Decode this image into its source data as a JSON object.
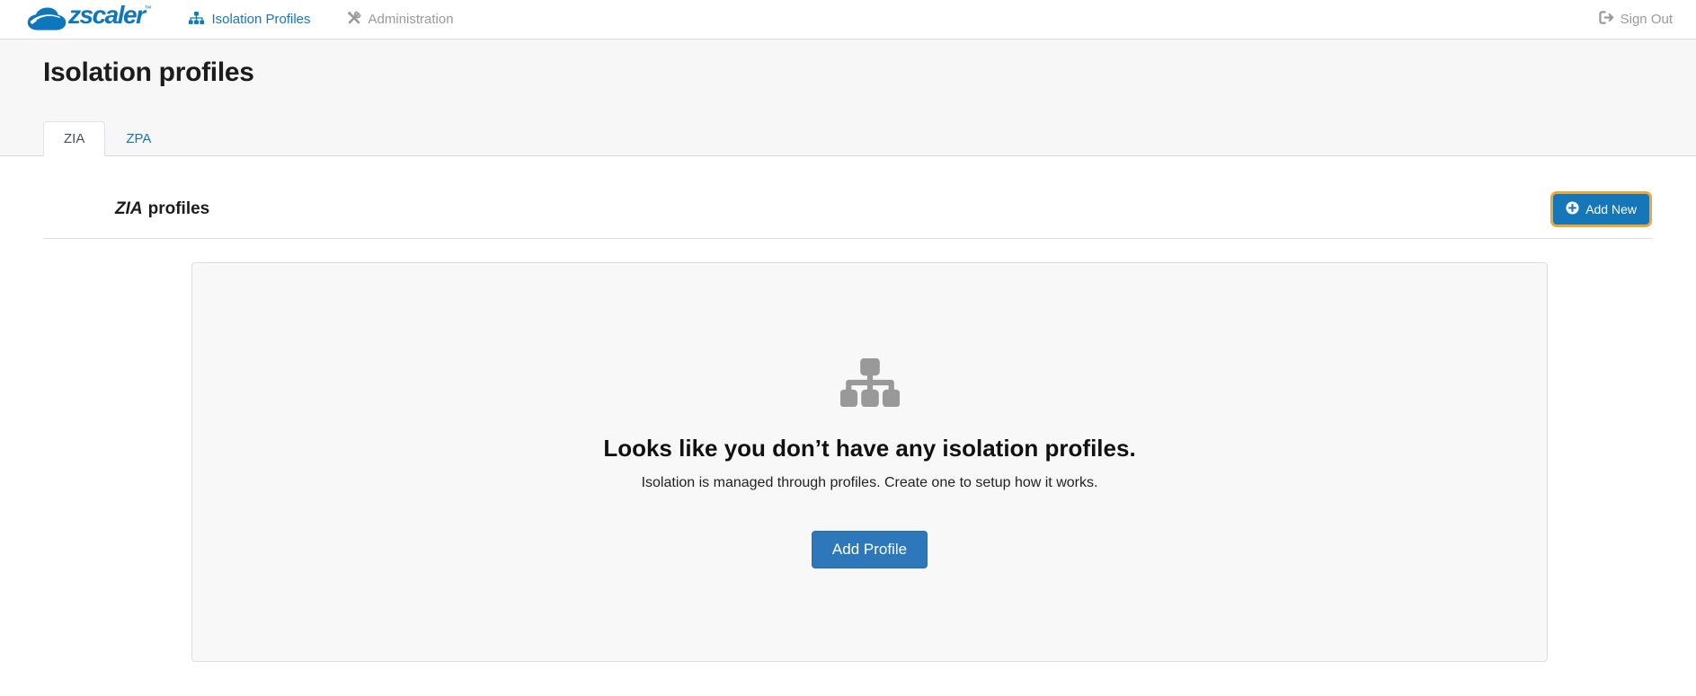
{
  "navbar": {
    "logo_text": "zscaler",
    "logo_tm": "™",
    "items": [
      {
        "label": "Isolation Profiles",
        "icon": "sitemap-icon",
        "active": true
      },
      {
        "label": "Administration",
        "icon": "tools-icon",
        "active": false
      }
    ],
    "sign_out_label": "Sign Out",
    "sign_out_icon": "sign-out-icon"
  },
  "header": {
    "title": "Isolation profiles",
    "tabs": [
      {
        "label": "ZIA",
        "active": true
      },
      {
        "label": "ZPA",
        "active": false
      }
    ]
  },
  "section": {
    "title_emphasis": "ZIA",
    "title_rest": "profiles",
    "add_new_label": "Add New",
    "add_new_icon": "plus-circle-icon"
  },
  "empty_state": {
    "icon": "sitemap-icon",
    "heading": "Looks like you don’t have any isolation profiles.",
    "description": "Isolation is managed through profiles. Create one to setup how it works.",
    "add_profile_label": "Add Profile"
  },
  "colors": {
    "brand_blue": "#0e76bc",
    "link_blue": "#1577b8",
    "muted_gray": "#9a9a9a",
    "focus_ring_amber": "#eda63a",
    "button_blue": "#2d77bb",
    "band_gray": "#f7f7f7",
    "card_gray": "#f8f8f8"
  }
}
